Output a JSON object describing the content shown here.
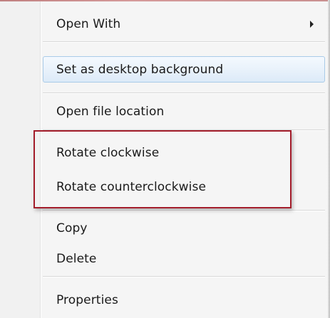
{
  "context_menu": {
    "items": [
      {
        "label": "Open With",
        "has_submenu": true,
        "submenu_icon": "chevron-right-icon"
      },
      {
        "label": "Set as desktop background",
        "highlighted": true
      },
      {
        "label": "Open file location"
      },
      {
        "label": "Rotate clockwise"
      },
      {
        "label": "Rotate counterclockwise"
      },
      {
        "label": "Copy"
      },
      {
        "label": "Delete"
      },
      {
        "label": "Properties"
      }
    ]
  },
  "colors": {
    "highlight_border": "#a9cbe8",
    "annotation_border": "#a31d2b",
    "menu_background": "#f5f5f5"
  }
}
